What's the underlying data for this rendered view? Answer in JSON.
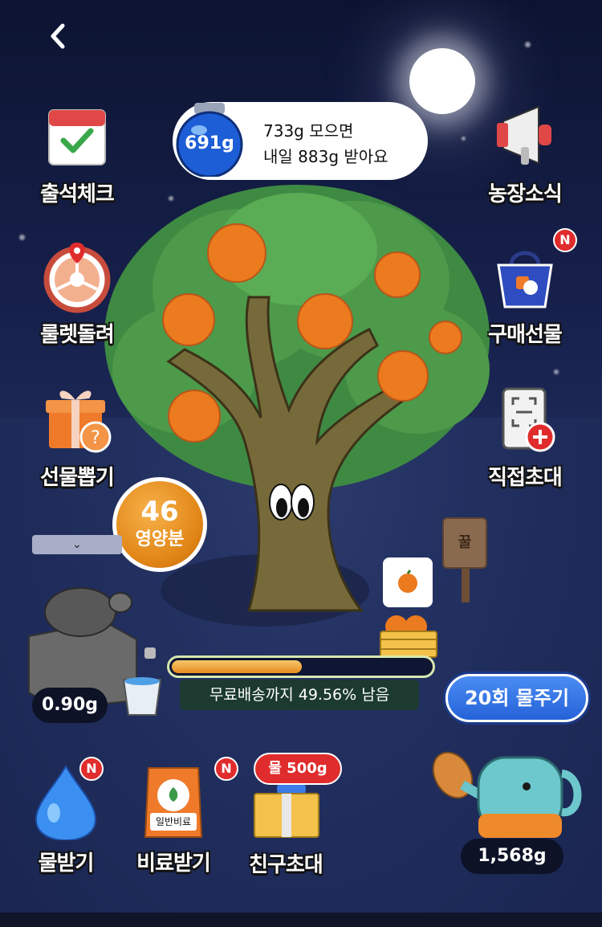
{
  "header": {
    "back_icon": "chevron-left-icon"
  },
  "water_jar": {
    "amount": "691g",
    "line1": "733g 모으면",
    "line2": "내일 883g 받아요"
  },
  "left_menu": [
    {
      "label": "출석체크",
      "icon": "calendar-check-icon"
    },
    {
      "label": "룰렛돌려",
      "icon": "roulette-icon"
    },
    {
      "label": "선물뽑기",
      "icon": "gift-box-icon"
    }
  ],
  "right_menu": [
    {
      "label": "농장소식",
      "icon": "megaphone-icon"
    },
    {
      "label": "구매선물",
      "icon": "shopping-bag-icon",
      "badge": "N"
    },
    {
      "label": "직접초대",
      "icon": "invite-icon"
    }
  ],
  "nutrient": {
    "count": "46",
    "label": "영양분"
  },
  "collapse_icon": "chevron-down-icon",
  "sign": {
    "text": "꿀"
  },
  "turtle": {
    "value": "0.90g"
  },
  "progress": {
    "text": "무료배송까지 49.56% 남음",
    "fraction": 0.5044
  },
  "water_button": {
    "label": "20회 물주기"
  },
  "watering_can": {
    "value": "1,568g"
  },
  "bottom_menu": [
    {
      "label": "물받기",
      "icon": "water-drop-icon",
      "badge": "N"
    },
    {
      "label": "비료받기",
      "icon": "fertilizer-bag-icon",
      "badge": "N",
      "bag_text": "일반비료"
    },
    {
      "label": "친구초대",
      "icon": "friend-gift-icon",
      "pill": "물 500g"
    }
  ],
  "colors": {
    "accent": "#2562d8",
    "badge": "#e02c2c",
    "orange": "#e18516",
    "leaf": "#4c9a4a"
  }
}
